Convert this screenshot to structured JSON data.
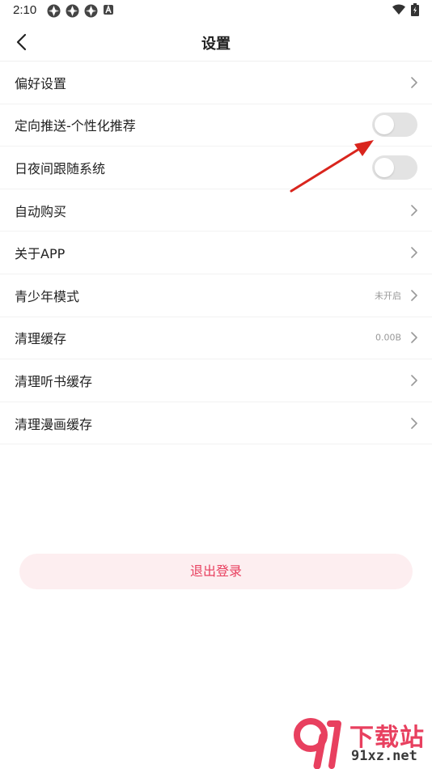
{
  "status_bar": {
    "time": "2:10",
    "icons": [
      "app-notification-icon",
      "app-notification-icon",
      "app-notification-icon",
      "a-badge-icon"
    ],
    "right_icons": [
      "wifi-icon",
      "battery-icon"
    ]
  },
  "nav": {
    "title": "设置",
    "back_icon": "back-arrow-icon"
  },
  "settings": {
    "items": [
      {
        "label": "偏好设置",
        "control": "chevron"
      },
      {
        "label": "定向推送-个性化推荐",
        "control": "toggle",
        "on": false
      },
      {
        "label": "日夜间跟随系统",
        "control": "toggle",
        "on": false
      },
      {
        "label": "自动购买",
        "control": "chevron"
      },
      {
        "label": "关于APP",
        "control": "chevron"
      },
      {
        "label": "青少年模式",
        "control": "chevron",
        "value": "未开启"
      },
      {
        "label": "清理缓存",
        "control": "chevron",
        "value": "0.00B"
      },
      {
        "label": "清理听书缓存",
        "control": "chevron"
      },
      {
        "label": "清理漫画缓存",
        "control": "chevron"
      }
    ]
  },
  "logout": {
    "label": "退出登录"
  },
  "watermark": {
    "title": "下载站",
    "url": "91xz.net"
  },
  "colors": {
    "accent": "#e8405f",
    "logout_bg": "#fdeef0",
    "toggle_off": "#e3e3e3",
    "annotation_arrow": "#d9251d"
  }
}
